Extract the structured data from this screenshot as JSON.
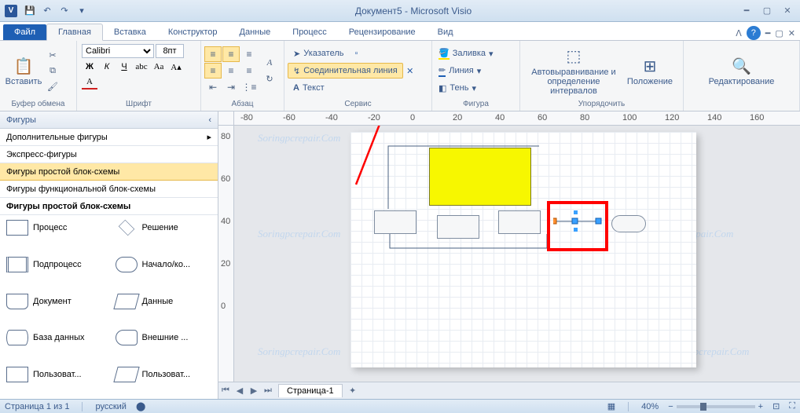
{
  "title": "Документ5  -  Microsoft Visio",
  "file_tab": "Файл",
  "tabs": [
    "Главная",
    "Вставка",
    "Конструктор",
    "Данные",
    "Процесс",
    "Рецензирование",
    "Вид"
  ],
  "ribbon": {
    "clipboard": {
      "label": "Буфер обмена",
      "paste": "Вставить"
    },
    "font": {
      "label": "Шрифт",
      "name": "Calibri",
      "size": "8пт"
    },
    "paragraph": {
      "label": "Абзац"
    },
    "service": {
      "label": "Сервис",
      "pointer": "Указатель",
      "connector": "Соединительная линия",
      "text": "Текст"
    },
    "figure": {
      "label": "Фигура",
      "fill": "Заливка",
      "line": "Линия",
      "shadow": "Тень"
    },
    "arrange": {
      "label": "Упорядочить",
      "auto": "Автовыравнивание и определение интервалов",
      "position": "Положение"
    },
    "edit": {
      "label": "Редактирование"
    }
  },
  "shapes": {
    "header": "Фигуры",
    "items": [
      "Дополнительные фигуры",
      "Экспресс-фигуры",
      "Фигуры простой блок-схемы",
      "Фигуры функциональной блок-схемы"
    ],
    "section_title": "Фигуры простой блок-схемы",
    "shapes": [
      {
        "name": "Процесс"
      },
      {
        "name": "Решение"
      },
      {
        "name": "Подпроцесс"
      },
      {
        "name": "Начало/ко..."
      },
      {
        "name": "Документ"
      },
      {
        "name": "Данные"
      },
      {
        "name": "База данных"
      },
      {
        "name": "Внешние ..."
      },
      {
        "name": "Пользоват..."
      },
      {
        "name": "Пользоват..."
      }
    ]
  },
  "ruler_h": [
    "-80",
    "-60",
    "-40",
    "-20",
    "0",
    "20",
    "40",
    "60",
    "80",
    "100",
    "120",
    "140",
    "160"
  ],
  "ruler_v": [
    "80",
    "60",
    "40",
    "20",
    "0"
  ],
  "page_tab": "Страница-1",
  "status": {
    "page": "Страница 1 из 1",
    "lang": "русский",
    "zoom": "40%"
  },
  "watermark": "Soringpcrepair.Com"
}
